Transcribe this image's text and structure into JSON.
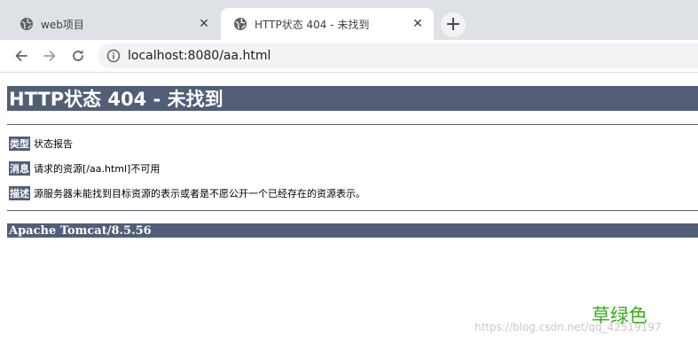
{
  "tabs": [
    {
      "title": "web项目",
      "active": false
    },
    {
      "title": "HTTP状态 404 - 未找到",
      "active": true
    }
  ],
  "new_tab_icon": "plus-icon",
  "toolbar": {
    "url": "localhost:8080/aa.html"
  },
  "error_page": {
    "heading": "HTTP状态 404 - 未找到",
    "rows": [
      {
        "label": "类型",
        "text": "状态报告"
      },
      {
        "label": "消息",
        "text": "请求的资源[/aa.html]不可用"
      },
      {
        "label": "描述",
        "text": "源服务器未能找到目标资源的表示或者是不愿公开一个已经存在的资源表示。"
      }
    ],
    "footer": "Apache Tomcat/8.5.56",
    "accent_color": "#525d76"
  },
  "watermark": "https://blog.csdn.net/qq_42519197",
  "overlay_text": "草绿色",
  "overlay_color": "#3aaa1c"
}
